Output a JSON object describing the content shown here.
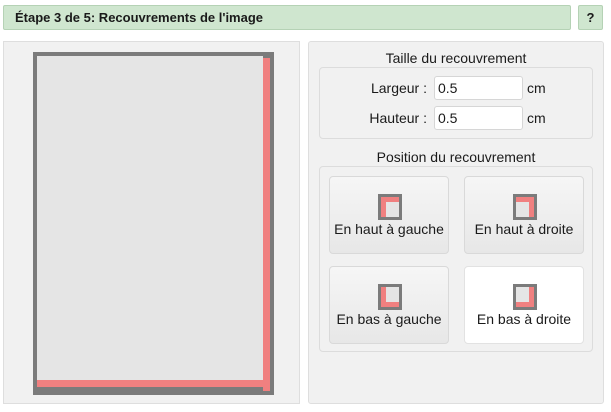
{
  "header": {
    "title": "Étape 3 de 5: Recouvrements de l'image",
    "help_label": "?"
  },
  "size_section": {
    "title": "Taille du recouvrement",
    "width": {
      "label": "Largeur :",
      "value": "0.5",
      "unit": "cm"
    },
    "height": {
      "label": "Hauteur :",
      "value": "0.5",
      "unit": "cm"
    }
  },
  "position_section": {
    "title": "Position du recouvrement",
    "buttons": [
      {
        "label": "En haut à gauche",
        "icon": "overlap-top-left-icon",
        "selected": false
      },
      {
        "label": "En haut à droite",
        "icon": "overlap-top-right-icon",
        "selected": false
      },
      {
        "label": "En bas à gauche",
        "icon": "overlap-bottom-left-icon",
        "selected": false
      },
      {
        "label": "En bas à droite",
        "icon": "overlap-bottom-right-icon",
        "selected": true
      }
    ]
  },
  "colors": {
    "overlap": "#f08080",
    "frame": "#7b7b7b",
    "page": "#e5e5e5",
    "header_bg": "#cfe6cf"
  }
}
